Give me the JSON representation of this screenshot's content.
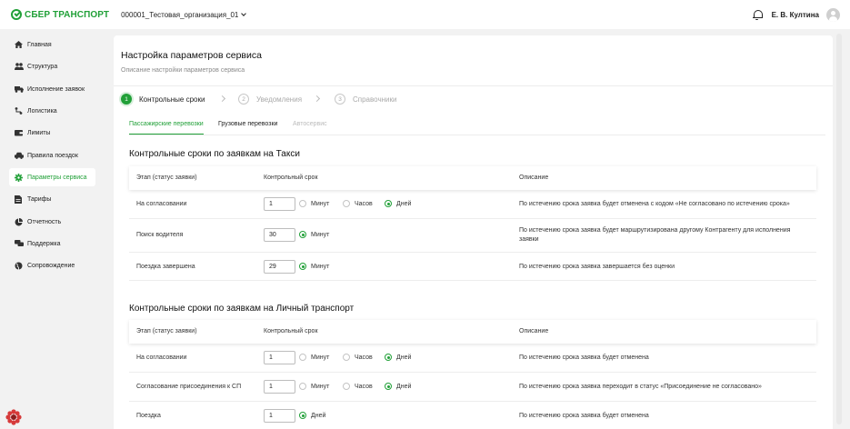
{
  "header": {
    "brand": "СБЕР ТРАНСПОРТ",
    "organization": "000001_Тестовая_организация_01",
    "user_name": "Е. В. Култина"
  },
  "sidebar": {
    "items": [
      {
        "label": "Главная",
        "icon": "home-icon"
      },
      {
        "label": "Структура",
        "icon": "users-icon"
      },
      {
        "label": "Исполнение заявок",
        "icon": "truck-icon"
      },
      {
        "label": "Логистика",
        "icon": "route-icon"
      },
      {
        "label": "Лимиты",
        "icon": "wallet-icon"
      },
      {
        "label": "Правила поездок",
        "icon": "car-icon"
      },
      {
        "label": "Параметры сервиса",
        "icon": "gear-icon"
      },
      {
        "label": "Тарифы",
        "icon": "document-icon"
      },
      {
        "label": "Отчетность",
        "icon": "pie-chart-icon"
      },
      {
        "label": "Поддержка",
        "icon": "chat-icon"
      },
      {
        "label": "Сопровождение",
        "icon": "globe-icon"
      }
    ],
    "active_index": 6
  },
  "page": {
    "title": "Настройка параметров сервиса",
    "subtitle": "Описание настройки параметров сервиса"
  },
  "steps": [
    {
      "num": "1",
      "label": "Контрольные сроки",
      "active": true
    },
    {
      "num": "2",
      "label": "Уведомления",
      "active": false
    },
    {
      "num": "3",
      "label": "Справочники",
      "active": false
    }
  ],
  "tabs": [
    {
      "label": "Пассажирские перевозки",
      "state": "active"
    },
    {
      "label": "Грузовые перевозки",
      "state": "normal"
    },
    {
      "label": "Автосервис",
      "state": "disabled"
    }
  ],
  "columns": {
    "stage": "Этап (статус заявки)",
    "deadline": "Контрольный срок",
    "description": "Описание"
  },
  "units": {
    "minutes": "Минут",
    "hours": "Часов",
    "days": "Дней"
  },
  "sections": [
    {
      "title": "Контрольные сроки по заявкам на Такси",
      "rows": [
        {
          "stage": "На согласовании",
          "value": "1",
          "description": "По истечению срока заявка будет отменена с кодом «Не согласовано по истечению срока»"
        },
        {
          "stage": "Поиск водителя",
          "value": "30",
          "description": "По истечению срока заявка будет маршрутизирована другому Контрагенту для исполнения заявки"
        },
        {
          "stage": "Поездка завершена",
          "value": "29",
          "description": "По истечению срока заявка завершается без оценки"
        }
      ]
    },
    {
      "title": "Контрольные сроки по заявкам на Личный транспорт",
      "rows": [
        {
          "stage": "На согласовании",
          "value": "1",
          "description": "По истечению срока заявка будет отменена"
        },
        {
          "stage": "Согласование присоединения к СП",
          "value": "1",
          "description": "По истечению срока заявка переходит в статус «Присоединение не согласовано»"
        },
        {
          "stage": "Поездка",
          "value": "1",
          "description": "По истечению срока заявка будет отменена"
        }
      ]
    }
  ],
  "colors": {
    "accent": "#21a038"
  }
}
